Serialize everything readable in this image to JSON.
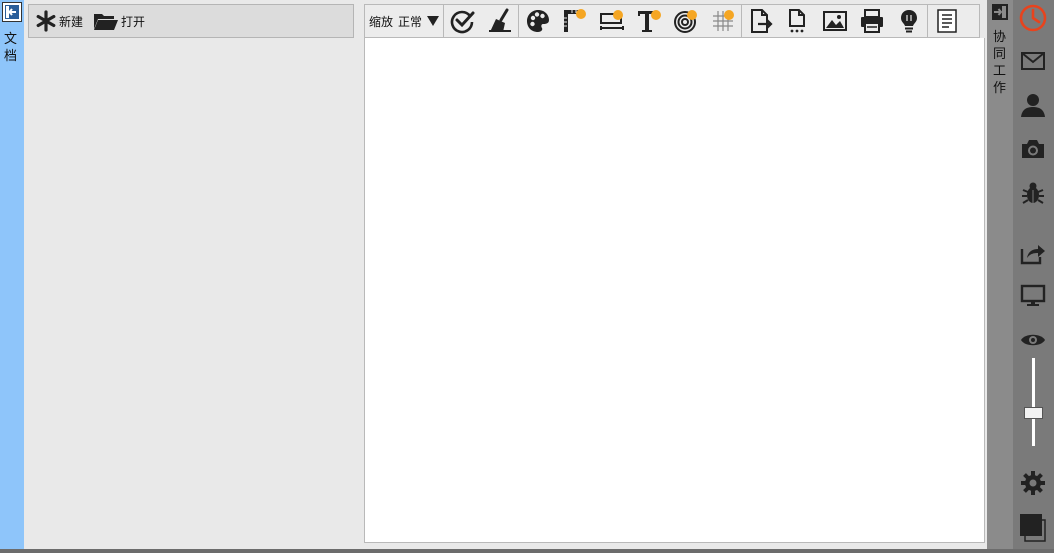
{
  "left_panel": {
    "vertical_label": "文\n档"
  },
  "doc_toolbar": {
    "new_label": "新建",
    "open_label": "打开"
  },
  "toolbar": {
    "zoom_label": "缩放",
    "zoom_value": "正常"
  },
  "collab_panel": {
    "vertical_label": "协\n同\n工\n作"
  },
  "right_bar": {
    "zoom_slider_level": 0.65
  },
  "colors": {
    "left_strip": "#8ec5fa",
    "accent_orange": "#f5a623",
    "clock_red": "#e8431d",
    "right_bar": "#7a7a7a"
  }
}
